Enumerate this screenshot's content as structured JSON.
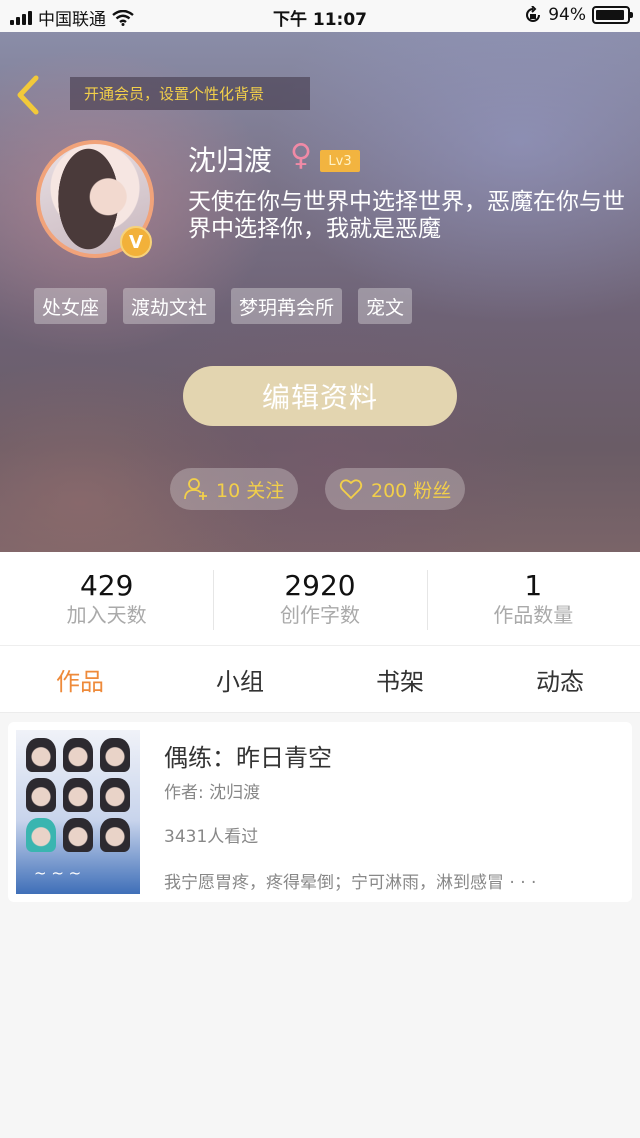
{
  "status_bar": {
    "carrier": "中国联通",
    "time": "下午 11:07",
    "battery_text": "94%",
    "battery_level": 0.94
  },
  "header": {
    "vip_banner": "开通会员，设置个性化背景",
    "username": "沈归渡",
    "gender_symbol": "♀",
    "level": "Lv3",
    "verified_badge": "V",
    "bio": "天使在你与世界中选择世界，恶魔在你与世界中选择你，我就是恶魔",
    "tags": [
      "处女座",
      "渡劫文社",
      "梦玥苒会所",
      "宠文"
    ],
    "edit_button": "编辑资料",
    "following": "10 关注",
    "followers": "200 粉丝"
  },
  "stats": [
    {
      "value": "429",
      "label": "加入天数"
    },
    {
      "value": "2920",
      "label": "创作字数"
    },
    {
      "value": "1",
      "label": "作品数量"
    }
  ],
  "tabs": [
    "作品",
    "小组",
    "书架",
    "动态"
  ],
  "active_tab": "作品",
  "book": {
    "title": "偶练：昨日青空",
    "author": "作者: 沈归渡",
    "views": "3431人看过",
    "summary": "我宁愿胃疼，疼得晕倒；宁可淋雨，淋到感冒 · · ·"
  },
  "colors": {
    "accent": "#ee8a3a",
    "gold": "#f2cf4a",
    "edit_button_bg": "#e3d5b0"
  }
}
